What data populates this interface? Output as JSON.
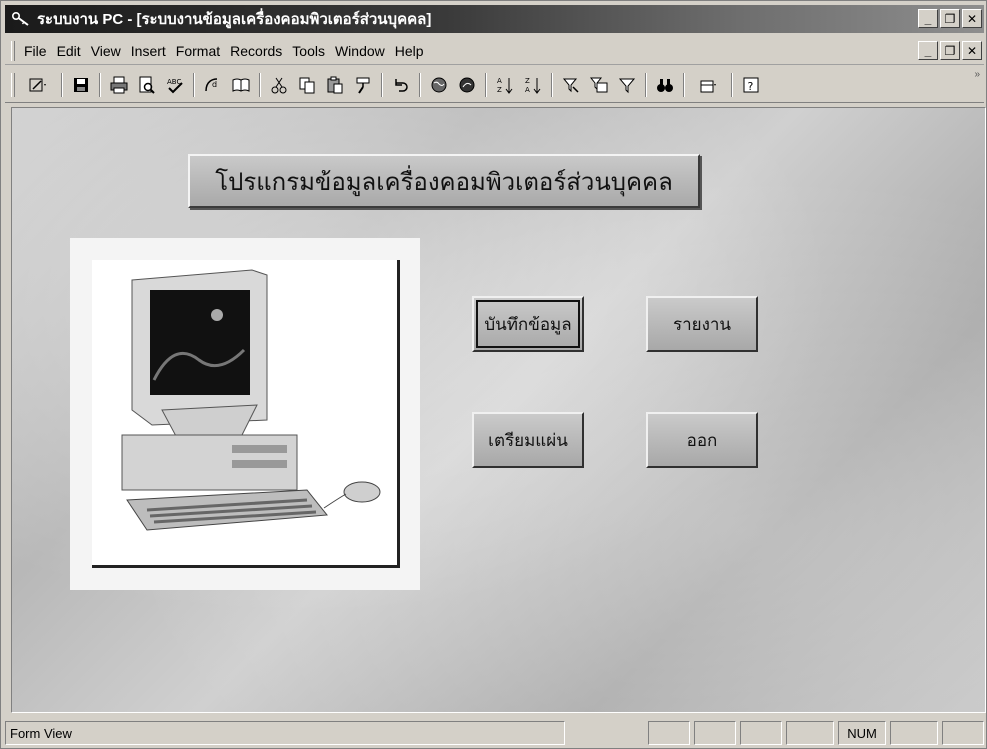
{
  "window": {
    "title": "ระบบงาน PC - [ระบบงานข้อมูลเครื่องคอมพิวเตอร์ส่วนบุคคล]",
    "app_icon": "key-pencil-icon"
  },
  "menu": {
    "items": [
      {
        "label": "File"
      },
      {
        "label": "Edit"
      },
      {
        "label": "View"
      },
      {
        "label": "Insert"
      },
      {
        "label": "Format"
      },
      {
        "label": "Records"
      },
      {
        "label": "Tools"
      },
      {
        "label": "Window"
      },
      {
        "label": "Help"
      }
    ]
  },
  "toolbar": {
    "icons": [
      "design-view-icon",
      "save-icon",
      "print-icon",
      "print-preview-icon",
      "spelling-icon",
      "format-painter-icon",
      "insert-hyperlink-icon",
      "cut-icon",
      "copy-icon",
      "paste-icon",
      "format-painter-brush-icon",
      "undo-icon",
      "web-icon",
      "web-toolbar-icon",
      "sort-ascending-icon",
      "sort-descending-icon",
      "filter-by-selection-icon",
      "filter-by-form-icon",
      "apply-filter-icon",
      "find-icon",
      "new-object-icon",
      "help-icon"
    ]
  },
  "form": {
    "title": "โปรแกรมข้อมูลเครื่องคอมพิวเตอร์ส่วนบุคคล",
    "buttons": {
      "record": "บันทึกข้อมูล",
      "report": "รายงาน",
      "prepare_disk": "เตรียมแผ่น",
      "exit": "ออก"
    }
  },
  "status": {
    "text": "Form View",
    "num": "NUM"
  },
  "colors": {
    "face": "#d4d0c8",
    "title_dark": "#1a1a1a"
  }
}
